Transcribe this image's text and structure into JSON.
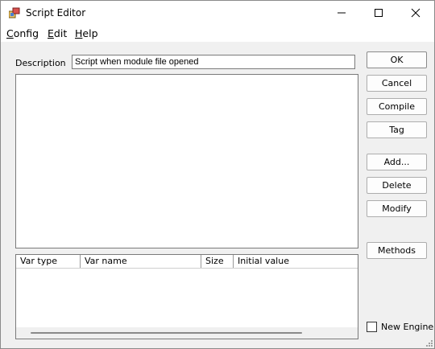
{
  "window": {
    "title": "Script Editor",
    "minimize_glyph": "—",
    "maximize_glyph": "☐",
    "close_glyph": "✕"
  },
  "menu": {
    "config_key": "C",
    "config_rest": "onfig",
    "edit_key": "E",
    "edit_rest": "dit",
    "help_key": "H",
    "help_rest": "elp"
  },
  "description": {
    "label": "Description",
    "value": "Script when module file opened"
  },
  "var_table": {
    "columns": [
      "Var type",
      "Var name",
      "Size",
      "Initial value"
    ]
  },
  "buttons": {
    "ok": "OK",
    "cancel": "Cancel",
    "compile": "Compile",
    "tag": "Tag",
    "add": "Add...",
    "delete": "Delete",
    "modify": "Modify",
    "methods": "Methods"
  },
  "new_engine": {
    "label": "New Engine",
    "checked": false
  }
}
